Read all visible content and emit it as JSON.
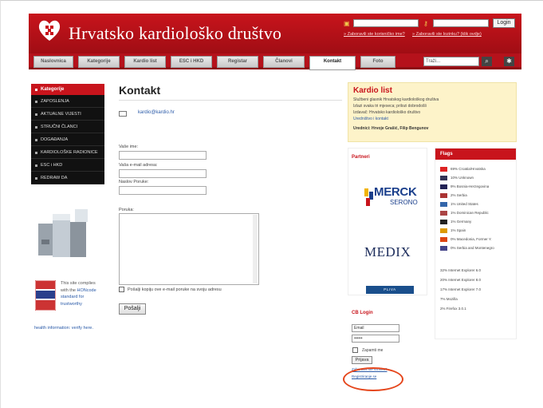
{
  "site": {
    "title": "Hrvatsko kardiološko društvo"
  },
  "header_login": {
    "button": "Login",
    "link_forgot_user": "» Zaboravili ste korisničko ime?",
    "link_forgot_pass": "» Zaboravili ste lozinku? (klik ovdje)"
  },
  "nav": {
    "tabs": [
      "Naslovnica",
      "Kategorije",
      "Kardio list",
      "ESC i HKD",
      "Registar",
      "Članovi",
      "Kontakt",
      "Foto"
    ],
    "active": "Kontakt",
    "search_placeholder": "Traži..."
  },
  "side_menu": {
    "head": "Kategorije",
    "items": [
      "ZAPOSLENJA",
      "AKTUALNE VIJESTI",
      "STRUČNI ČLANCI",
      "DOGAĐANJA",
      "KARDIOLOŠKE RADIONICE",
      "ESC i HKD",
      "REDRAW DA"
    ]
  },
  "hon": {
    "text_part1": "This site complies with the",
    "link": "HONcode standard for trustworthy",
    "text_part2": "health information: verify here."
  },
  "contact": {
    "title": "Kontakt",
    "email": "kardio@kardio.hr",
    "labels": {
      "name": "Vaše ime:",
      "email": "Vaša e-mail adresa:",
      "subject": "Naslov Poruke:",
      "message": "Poruka:"
    },
    "copy_label": "Pošalji kopiju ove e-mail poruke na svoju adresu",
    "submit": "Pošalji"
  },
  "kardio_list": {
    "title": "Kardio list",
    "lines": [
      "Službeni glasnik Hrvatskog kardiološkog društva",
      "Izlazi svaka tri mjeseca; prilozi dobrodošli",
      "Izdavač: Hrvatsko kardiološko društvo"
    ],
    "link": "Uredništvo i kontakt",
    "authors": "Urednici: Hrvoje Grašić, Filip Bengunov"
  },
  "partners": {
    "title": "Partneri",
    "merck_word": "MERCK",
    "merck_sub": "SERONO",
    "medix": "MEDIX",
    "pliva": "PLIVA"
  },
  "flags": {
    "head": "Flags",
    "rows": [
      {
        "text": "69% Croatia/Hrvatska",
        "color": "#d22"
      },
      {
        "text": "10% Unknown",
        "color": "#335"
      },
      {
        "text": "9% Bosnia-Herzegovina",
        "color": "#225"
      },
      {
        "text": "2% Serbia",
        "color": "#a33"
      },
      {
        "text": "1% United States",
        "color": "#36a"
      },
      {
        "text": "1% Dominican Republic",
        "color": "#a44"
      },
      {
        "text": "1% Germany",
        "color": "#222"
      },
      {
        "text": "1% Spain",
        "color": "#d90"
      },
      {
        "text": "0% Macedonia, Former Y.",
        "color": "#d41"
      },
      {
        "text": "0% Serbia and Montenegro",
        "color": "#448"
      }
    ],
    "browsers": [
      "32% Internet Explorer 6.0",
      "20% Internet Explorer 8.0",
      "17% Internet Explorer 7.0",
      "7% Mozilla",
      "2% Firefox 3.0.1"
    ]
  },
  "cb_login": {
    "title": "CB Login",
    "email_value": "Email",
    "password_value": "••••••",
    "remember": "Zapamti me",
    "button": "Prijava",
    "link_forgot": "Zaboravili ste lozinku?",
    "link_register": "Registriranje se"
  }
}
